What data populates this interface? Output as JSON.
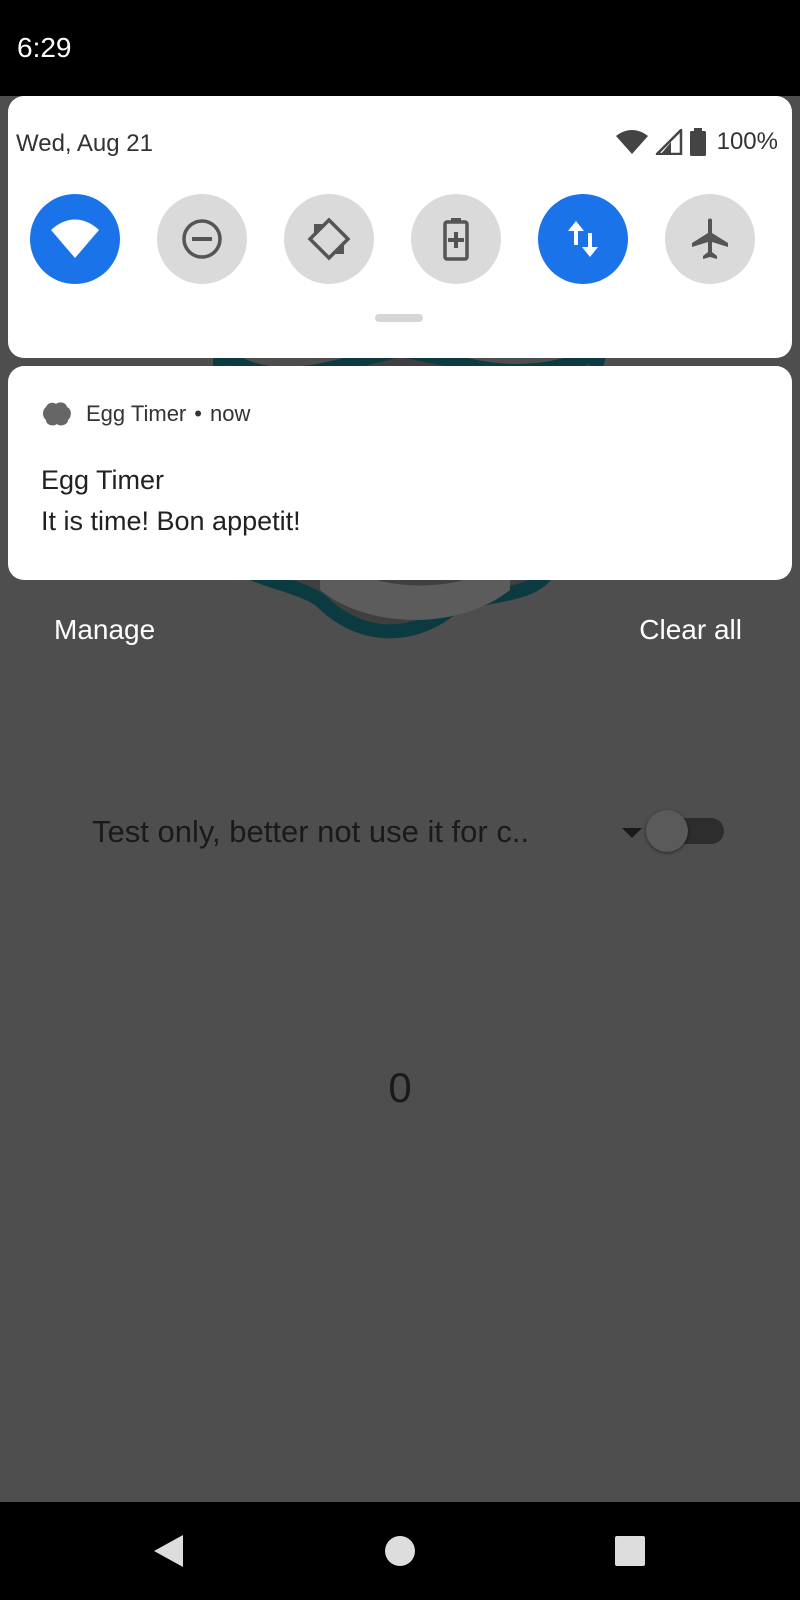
{
  "status_bar": {
    "time": "6:29"
  },
  "quick_settings": {
    "date": "Wed, Aug 21",
    "battery_percent": "100%",
    "tiles": [
      {
        "name": "wifi",
        "active": true
      },
      {
        "name": "do-not-disturb",
        "active": false
      },
      {
        "name": "auto-rotate",
        "active": false
      },
      {
        "name": "battery-saver",
        "active": false
      },
      {
        "name": "mobile-data",
        "active": true
      },
      {
        "name": "airplane-mode",
        "active": false
      }
    ]
  },
  "notification": {
    "app_name": "Egg Timer",
    "separator": "•",
    "time": "now",
    "title": "Egg Timer",
    "text": "It is time! Bon appetit!"
  },
  "shade_actions": {
    "manage": "Manage",
    "clear_all": "Clear all"
  },
  "app": {
    "spinner_selected": "Test only, better not use it for c..",
    "switch_on": false,
    "timer_value": "0"
  },
  "colors": {
    "accent": "#1a73e8",
    "scrim": "#4e4e4e"
  }
}
